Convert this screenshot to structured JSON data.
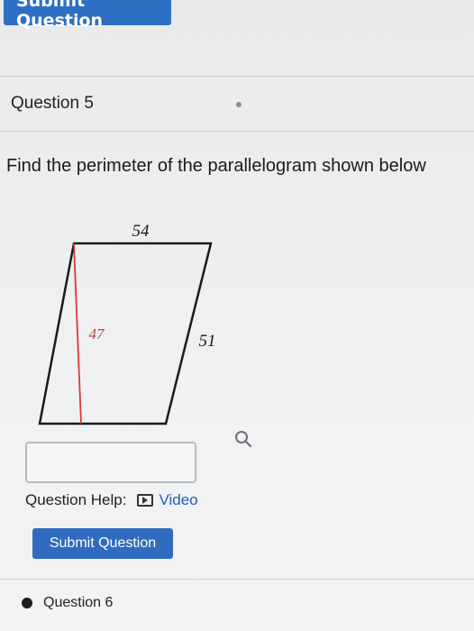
{
  "top_button": {
    "label": "Submit Question"
  },
  "question": {
    "title": "Question 5",
    "prompt": "Find the perimeter of the parallelogram shown below"
  },
  "diagram": {
    "top_label": "54",
    "height_label": "47",
    "side_label": "51",
    "height_color": "#d63a3a",
    "outline_color": "#1a1a1a"
  },
  "help": {
    "label": "Question Help:",
    "video_label": "Video"
  },
  "submit": {
    "label": "Submit Question"
  },
  "next_question": {
    "label": "Question 6"
  }
}
